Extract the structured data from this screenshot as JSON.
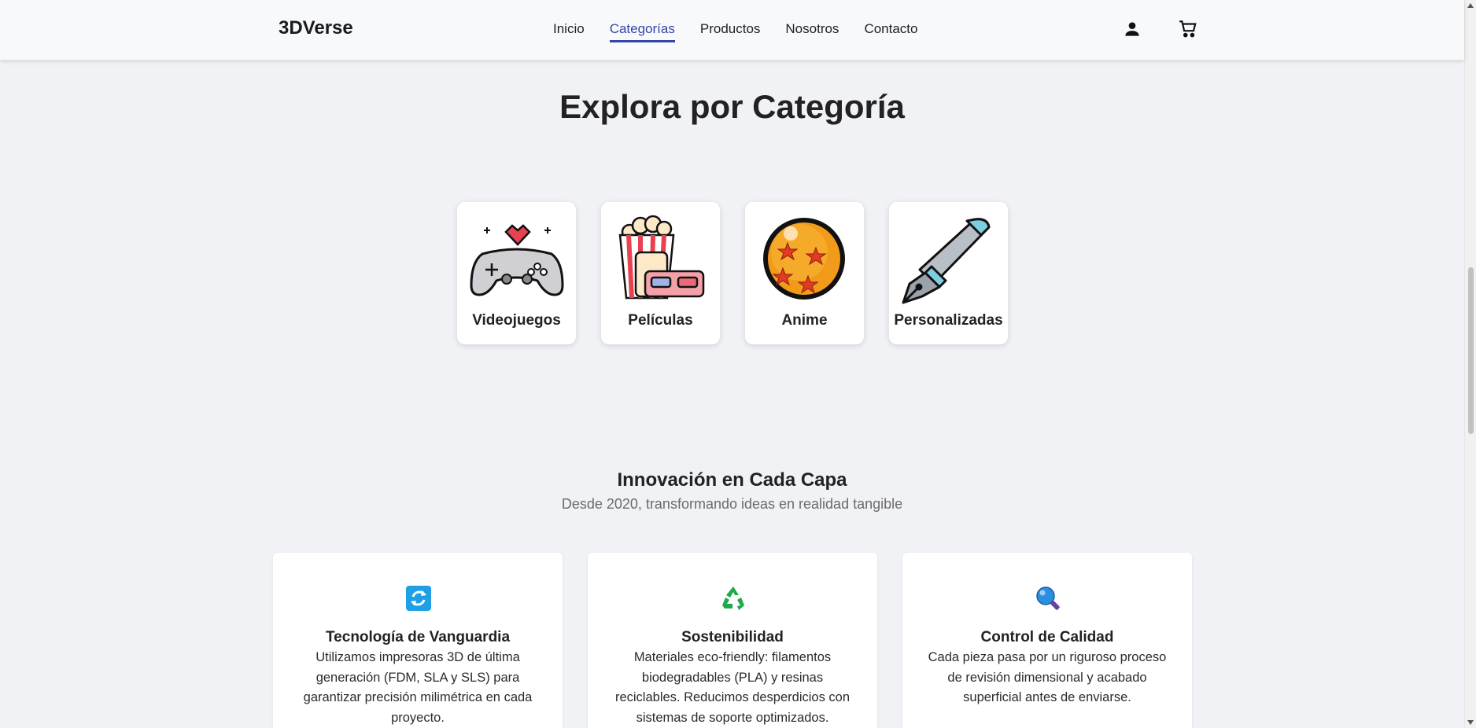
{
  "header": {
    "brand": "3DVerse",
    "nav": [
      "Inicio",
      "Categorías",
      "Productos",
      "Nosotros",
      "Contacto"
    ],
    "active_nav": "Categorías",
    "icons": [
      "user-icon",
      "cart-icon"
    ]
  },
  "categories": {
    "title": "Explora por Categoría",
    "items": [
      {
        "label": "Videojuegos",
        "icon": "gamepad-icon"
      },
      {
        "label": "Películas",
        "icon": "popcorn-icon"
      },
      {
        "label": "Anime",
        "icon": "dragon-ball-icon"
      },
      {
        "label": "Personalizadas",
        "icon": "pen-icon"
      }
    ]
  },
  "innovation": {
    "title": "Innovación en Cada Capa",
    "subtitle": "Desde 2020, transformando ideas en realidad tangible",
    "features": [
      {
        "icon": "refresh-icon",
        "title": "Tecnología de Vanguardia",
        "desc": "Utilizamos impresoras 3D de última generación (FDM, SLA y SLS) para garantizar precisión milimétrica en cada proyecto."
      },
      {
        "icon": "recycle-icon",
        "title": "Sostenibilidad",
        "desc": "Materiales eco-friendly: filamentos biodegradables (PLA) y resinas reciclables. Reducimos desperdicios con sistemas de soporte optimizados."
      },
      {
        "icon": "magnifier-icon",
        "title": "Control de Calidad",
        "desc": "Cada pieza pasa por un riguroso proceso de revisión dimensional y acabado superficial antes de enviarse."
      }
    ]
  },
  "colors": {
    "accent": "#3446a8",
    "background": "#f1f2f6",
    "card": "#ffffff"
  }
}
